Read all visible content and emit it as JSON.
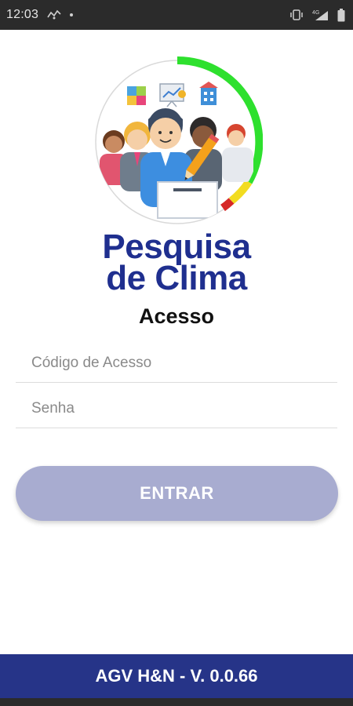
{
  "status_bar": {
    "time": "12:03",
    "network_type": "4G",
    "icons": [
      "gps-status-icon",
      "notification-dot-icon",
      "vibrate-icon",
      "signal-icon",
      "battery-icon"
    ]
  },
  "brand": {
    "line1": "Pesquisa",
    "line2": "de Clima",
    "color": "#1f2f8f"
  },
  "login": {
    "heading": "Acesso",
    "code_placeholder": "Código de Acesso",
    "code_value": "",
    "password_placeholder": "Senha",
    "password_value": "",
    "submit_label": "ENTRAR",
    "submit_color": "#a8acd0"
  },
  "footer": {
    "version_label": "AGV H&N - V. 0.0.66",
    "color": "#263488"
  }
}
